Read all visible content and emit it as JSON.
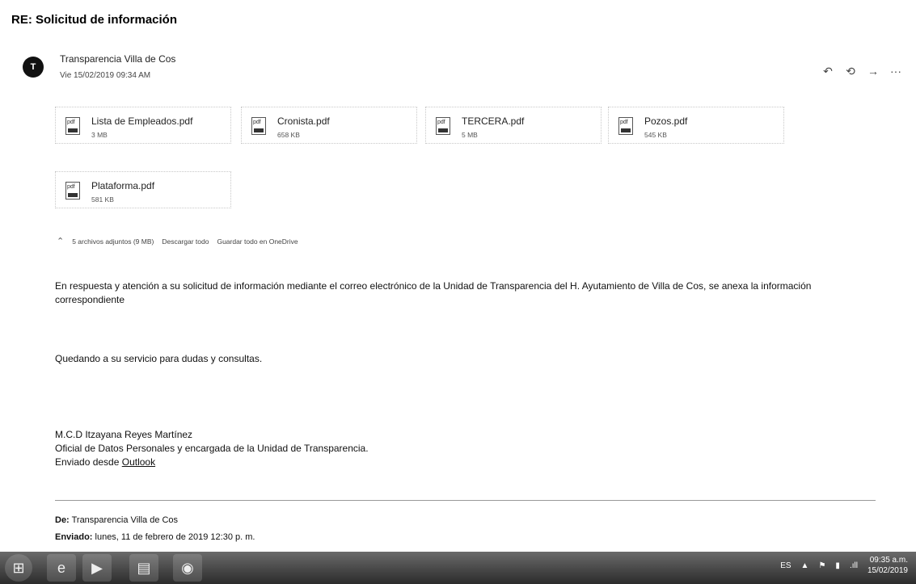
{
  "subject": "RE: Solicitud de información",
  "sender": {
    "initial": "T",
    "name": "Transparencia Villa de Cos",
    "date": "Vie 15/02/2019 09:34 AM"
  },
  "attachments": [
    {
      "name": "Lista de Empleados.pdf",
      "size": "3 MB"
    },
    {
      "name": "Cronista.pdf",
      "size": "658 KB"
    },
    {
      "name": "TERCERA.pdf",
      "size": "5 MB"
    },
    {
      "name": "Pozos.pdf",
      "size": "545 KB"
    },
    {
      "name": "Plataforma.pdf",
      "size": "581 KB"
    }
  ],
  "attachment_icon_label": "pdf",
  "attachment_summary": {
    "count": "5 archivos adjuntos (9 MB)",
    "download_all": "Descargar todo",
    "save_onedrive": "Guardar todo en OneDrive"
  },
  "body": {
    "paragraph1_line1": "En respuesta y  atención a su solicitud de información mediante el correo electrónico de la Unidad de Transparencia del H. Ayutamiento de Villa de Cos, se anexa la información",
    "paragraph1_line2": "correspondiente",
    "paragraph2": "Quedando a su servicio para dudas y consultas.",
    "signature_name": "M.C.D Itzayana Reyes Martínez",
    "signature_title": "Oficial de Datos Personales y encargada de la Unidad de Transparencia.",
    "sent_from_prefix": "Enviado desde ",
    "sent_from_link": "Outlook"
  },
  "quoted_header": {
    "from_label": "De:",
    "from_value": " Transparencia Villa de Cos",
    "sent_label": "Enviado:",
    "sent_value": " lunes, 11 de febrero de 2019 12:30 p. m."
  },
  "taskbar": {
    "language": "ES",
    "time": "09:35 a.m.",
    "date": "15/02/2019"
  }
}
